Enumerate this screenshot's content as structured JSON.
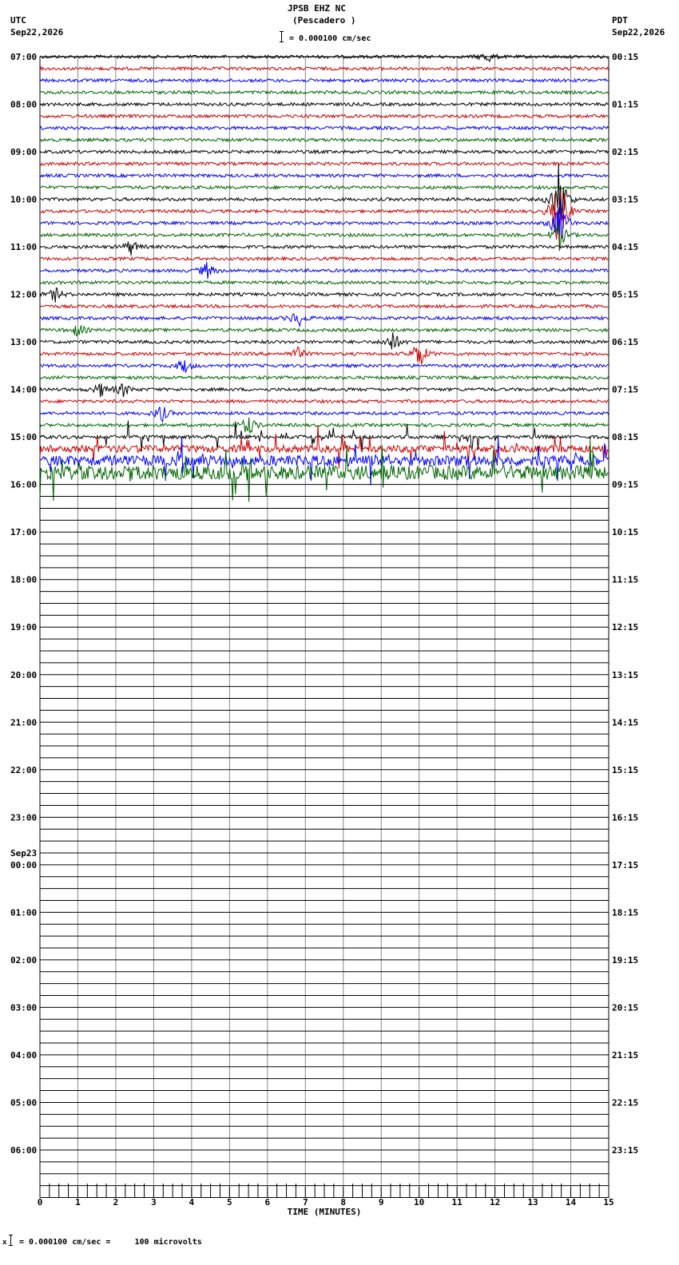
{
  "header": {
    "station": "JPSB EHZ NC",
    "location": "(Pescadero )",
    "left_tz": "UTC",
    "left_date": "Sep22,2026",
    "right_tz": "PDT",
    "right_date": "Sep22,2026",
    "scale_text": "= 0.000100 cm/sec"
  },
  "footer": {
    "prefix": "x",
    "scale_text": "= 0.000100 cm/sec =     100 microvolts"
  },
  "chart_data": {
    "type": "line",
    "title": "JPSB EHZ NC (Pescadero )",
    "xlabel": "TIME (MINUTES)",
    "ylabel": "",
    "xlim": [
      0,
      15
    ],
    "x_ticks": [
      "0",
      "1",
      "2",
      "3",
      "4",
      "5",
      "6",
      "7",
      "8",
      "9",
      "10",
      "11",
      "12",
      "13",
      "14",
      "15"
    ],
    "trace_colors": [
      "#000000",
      "#cc0000",
      "#0000ff",
      "#006400"
    ],
    "grid": true,
    "traces_per_hour": 4,
    "hours_total": 24,
    "active_traces": 36,
    "left_hour_labels": [
      "07:00",
      "08:00",
      "09:00",
      "10:00",
      "11:00",
      "12:00",
      "13:00",
      "14:00",
      "15:00",
      "16:00",
      "17:00",
      "18:00",
      "19:00",
      "20:00",
      "21:00",
      "22:00",
      "23:00",
      "00:00",
      "01:00",
      "02:00",
      "03:00",
      "04:00",
      "05:00",
      "06:00"
    ],
    "right_hour_labels": [
      "00:15",
      "01:15",
      "02:15",
      "03:15",
      "04:15",
      "05:15",
      "06:15",
      "07:15",
      "08:15",
      "09:15",
      "10:15",
      "11:15",
      "12:15",
      "13:15",
      "14:15",
      "15:15",
      "16:15",
      "17:15",
      "18:15",
      "19:15",
      "20:15",
      "21:15",
      "22:15",
      "23:15"
    ],
    "date_change": {
      "hour_index": 17,
      "label": "Sep23"
    },
    "events": [
      {
        "trace": 0,
        "minute": 11.8,
        "amplitude": 8
      },
      {
        "trace": 12,
        "minute": 13.7,
        "amplitude": 55
      },
      {
        "trace": 13,
        "minute": 13.7,
        "amplitude": 60
      },
      {
        "trace": 14,
        "minute": 13.7,
        "amplitude": 35
      },
      {
        "trace": 15,
        "minute": 13.7,
        "amplitude": 18
      },
      {
        "trace": 16,
        "minute": 2.4,
        "amplitude": 10
      },
      {
        "trace": 18,
        "minute": 4.4,
        "amplitude": 11
      },
      {
        "trace": 20,
        "minute": 0.4,
        "amplitude": 9
      },
      {
        "trace": 22,
        "minute": 6.8,
        "amplitude": 12
      },
      {
        "trace": 23,
        "minute": 1.0,
        "amplitude": 9
      },
      {
        "trace": 24,
        "minute": 9.3,
        "amplitude": 14
      },
      {
        "trace": 25,
        "minute": 10.0,
        "amplitude": 20
      },
      {
        "trace": 25,
        "minute": 6.8,
        "amplitude": 8
      },
      {
        "trace": 26,
        "minute": 3.8,
        "amplitude": 10
      },
      {
        "trace": 28,
        "minute": 1.6,
        "amplitude": 9
      },
      {
        "trace": 28,
        "minute": 2.2,
        "amplitude": 9
      },
      {
        "trace": 30,
        "minute": 3.2,
        "amplitude": 12
      },
      {
        "trace": 31,
        "minute": 5.5,
        "amplitude": 14
      }
    ]
  }
}
